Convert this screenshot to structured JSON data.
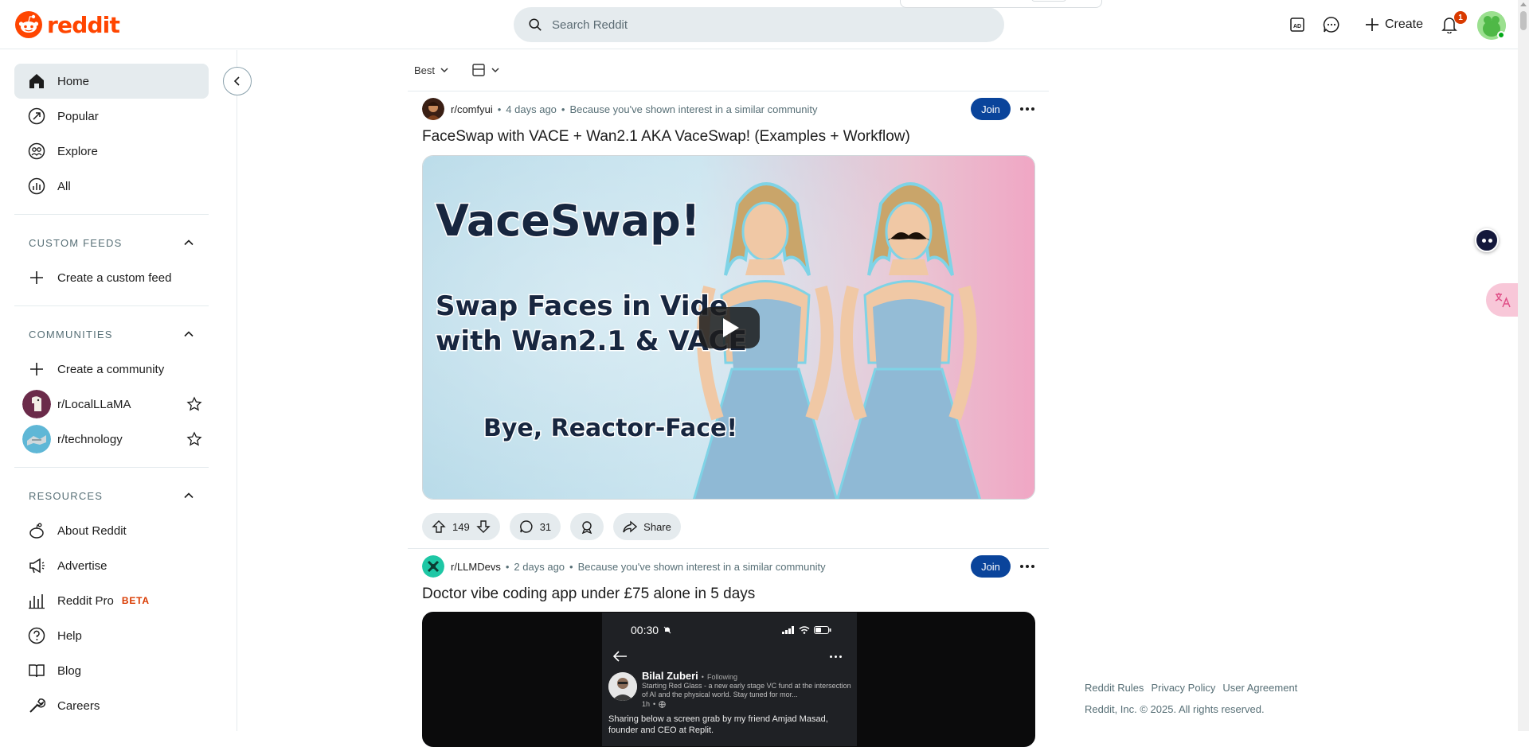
{
  "header": {
    "logo_text": "reddit",
    "search_placeholder": "Search Reddit",
    "create_label": "Create",
    "notification_count": "1"
  },
  "sidebar": {
    "nav": [
      {
        "label": "Home",
        "icon": "home-icon",
        "active": true
      },
      {
        "label": "Popular",
        "icon": "popular-icon"
      },
      {
        "label": "Explore",
        "icon": "explore-icon"
      },
      {
        "label": "All",
        "icon": "all-icon"
      }
    ],
    "custom_feeds": {
      "title": "CUSTOM FEEDS",
      "create_label": "Create a custom feed"
    },
    "communities": {
      "title": "COMMUNITIES",
      "create_label": "Create a community",
      "items": [
        {
          "name": "r/LocalLLaMA"
        },
        {
          "name": "r/technology"
        }
      ]
    },
    "resources": {
      "title": "RESOURCES",
      "items": [
        {
          "label": "About Reddit",
          "icon": "about-reddit-icon"
        },
        {
          "label": "Advertise",
          "icon": "advertise-icon"
        },
        {
          "label": "Reddit Pro",
          "icon": "reddit-pro-icon",
          "badge": "BETA"
        },
        {
          "label": "Help",
          "icon": "help-icon"
        },
        {
          "label": "Blog",
          "icon": "blog-icon"
        },
        {
          "label": "Careers",
          "icon": "careers-icon"
        }
      ]
    }
  },
  "feed": {
    "sort_label": "Best",
    "posts": [
      {
        "subreddit": "r/comfyui",
        "time": "4 days ago",
        "reason": "Because you've shown interest in a similar community",
        "join_label": "Join",
        "title": "FaceSwap with VACE + Wan2.1 AKA VaceSwap! (Examples + Workflow)",
        "thumb": {
          "headline": "VaceSwap!",
          "line1": "Swap Faces in Vide",
          "line2": "with Wan2.1 & VACE",
          "tagline": "Bye, Reactor-Face!"
        },
        "votes": "149",
        "comments": "31",
        "share_label": "Share"
      },
      {
        "subreddit": "r/LLMDevs",
        "time": "2 days ago",
        "reason": "Because you've shown interest in a similar community",
        "join_label": "Join",
        "title": "Doctor vibe coding app under £75 alone in 5 days",
        "phone": {
          "time": "00:30",
          "author": "Bilal Zuberi",
          "following": "Following",
          "bio": "Starting Red Glass - a new early stage VC fund at the intersection of AI and the physical world. Stay tuned for mor...",
          "meta": "1h",
          "body_line1": "Sharing below a screen grab by my friend Amjad Masad,",
          "body_line2": "founder and CEO at Replit."
        }
      }
    ]
  },
  "footer": {
    "links": [
      "Reddit Rules",
      "Privacy Policy",
      "User Agreement"
    ],
    "copyright": "Reddit, Inc. © 2025. All rights reserved."
  },
  "colors": {
    "brand": "#ff4500",
    "join": "#0a449b",
    "badge": "#d93a00",
    "active_bg": "#e5ebee"
  }
}
